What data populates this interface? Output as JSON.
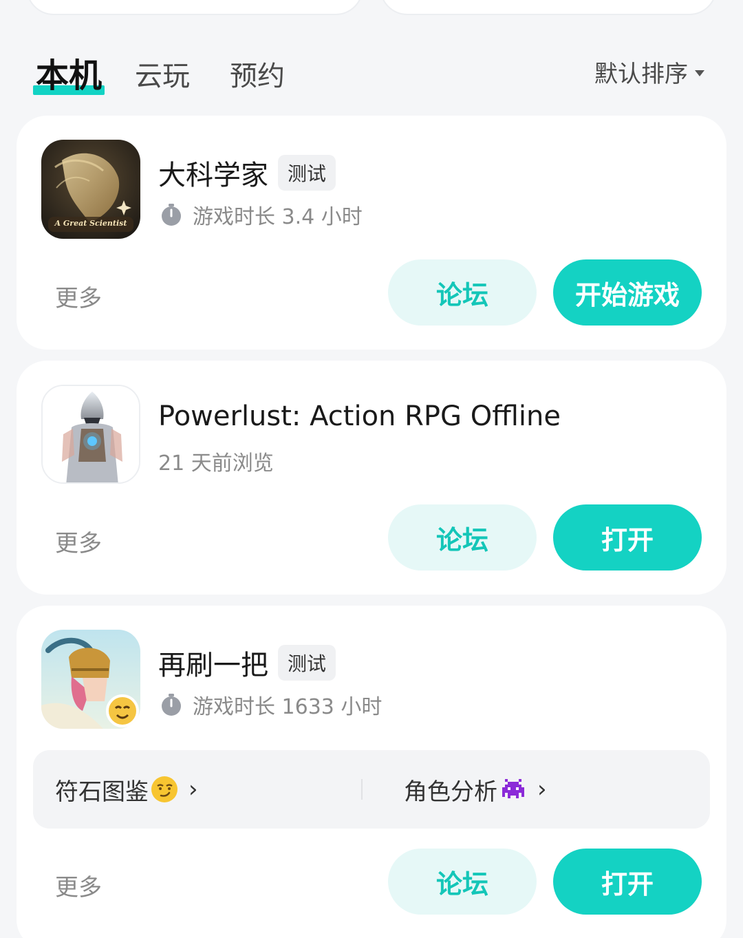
{
  "tabs": {
    "items": [
      {
        "label": "本机"
      },
      {
        "label": "云玩"
      },
      {
        "label": "预约"
      }
    ],
    "sort_label": "默认排序"
  },
  "games": [
    {
      "title": "大科学家",
      "tag": "测试",
      "meta": "游戏时长 3.4 小时",
      "icon_caption": "A Great Scientist",
      "more": "更多",
      "forum": "论坛",
      "action": "开始游戏"
    },
    {
      "title": "Powerlust: Action RPG Offline",
      "meta": "21 天前浏览",
      "more": "更多",
      "forum": "论坛",
      "action": "打开"
    },
    {
      "title": "再刷一把",
      "tag": "测试",
      "meta": "游戏时长 1633 小时",
      "more": "更多",
      "forum": "论坛",
      "action": "打开",
      "quick_links": [
        {
          "label": "符石图鉴",
          "emoji": "smirk-emoji"
        },
        {
          "label": "角色分析",
          "emoji": "alien-monster-emoji"
        }
      ]
    }
  ],
  "colors": {
    "accent": "#14d2c3",
    "accent_soft": "#e6f8f7",
    "background": "#f5f6f8"
  }
}
